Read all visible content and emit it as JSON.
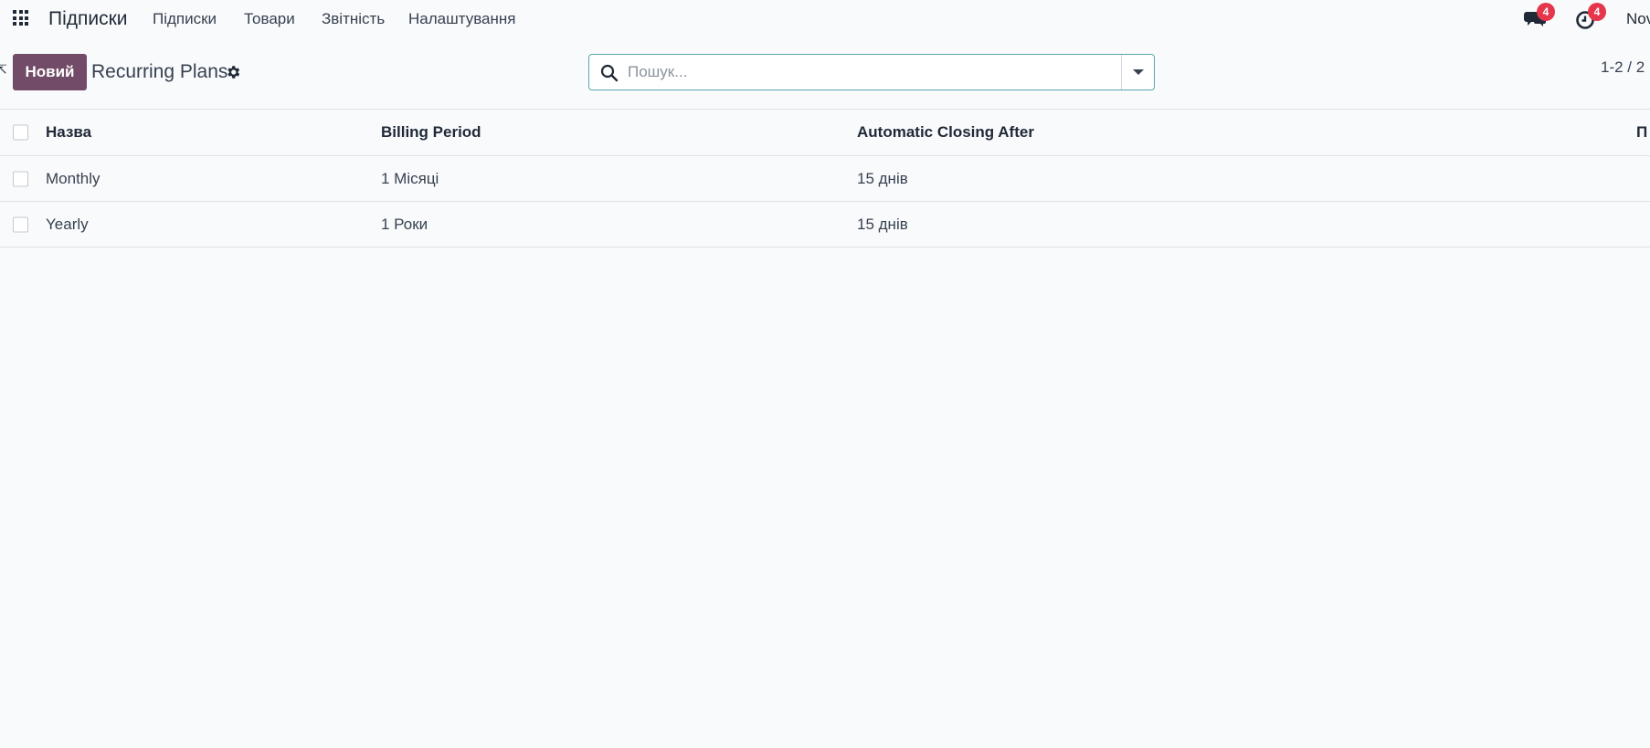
{
  "navbar": {
    "app_name": "Підписки",
    "menu": [
      "Підписки",
      "Товари",
      "Звітність",
      "Налаштування"
    ],
    "messages_badge": "4",
    "activities_badge": "4",
    "user_name": "Nova"
  },
  "control_panel": {
    "new_button": "Новий",
    "title": "Recurring Plans",
    "search_placeholder": "Пошук...",
    "pager": "1-2 / 2"
  },
  "table": {
    "columns": [
      "Назва",
      "Billing Period",
      "Automatic Closing After",
      "П"
    ],
    "rows": [
      {
        "name": "Monthly",
        "billing_period": "1 Місяці",
        "closing_after": "15 днів"
      },
      {
        "name": "Yearly",
        "billing_period": "1 Роки",
        "closing_after": "15 днів"
      }
    ]
  },
  "colors": {
    "primary": "#714b67",
    "badge": "#e5364b",
    "search_border": "#5aa4b0",
    "background": "#f9fafb"
  },
  "icons": [
    "apps-grid-icon",
    "chat-icon",
    "clock-icon",
    "gear-icon",
    "search-icon",
    "caret-down-icon"
  ]
}
